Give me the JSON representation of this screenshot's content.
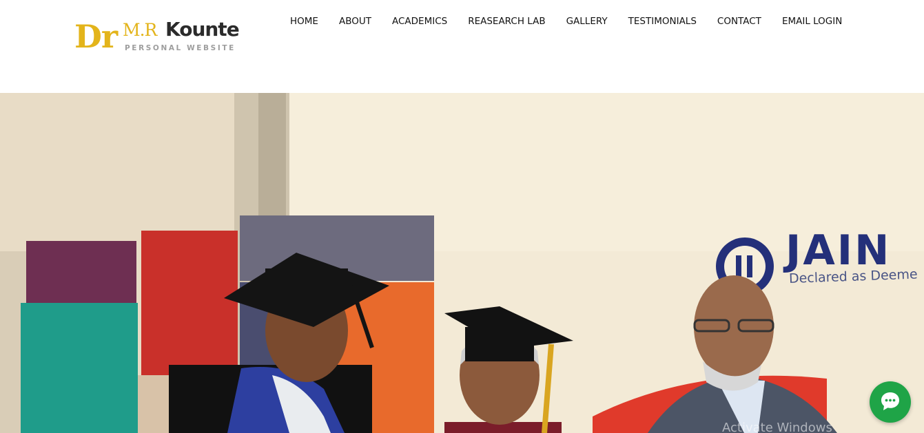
{
  "logo": {
    "dr": "Dr",
    "initials": "M.R",
    "surname": "Kounte",
    "tagline": "PERSONAL WEBSITE"
  },
  "nav": {
    "items": [
      {
        "label": "HOME"
      },
      {
        "label": "ABOUT"
      },
      {
        "label": "ACADEMICS"
      },
      {
        "label": "REASEARCH LAB"
      },
      {
        "label": "GALLERY"
      },
      {
        "label": "TESTIMONIALS"
      },
      {
        "label": "CONTACT"
      },
      {
        "label": "EMAIL LOGIN"
      }
    ]
  },
  "hero": {
    "banner_brand": "JAIN",
    "banner_subtitle": "Declared as Deeme",
    "watermark": "Activate Windows"
  },
  "chat": {
    "icon": "chat-bubble-icon",
    "color": "#1fa447"
  },
  "colors": {
    "logo_gold": "#e3b41b",
    "logo_dark": "#2b2b2b",
    "nav_text": "#111111",
    "banner_blue": "#24307a"
  }
}
